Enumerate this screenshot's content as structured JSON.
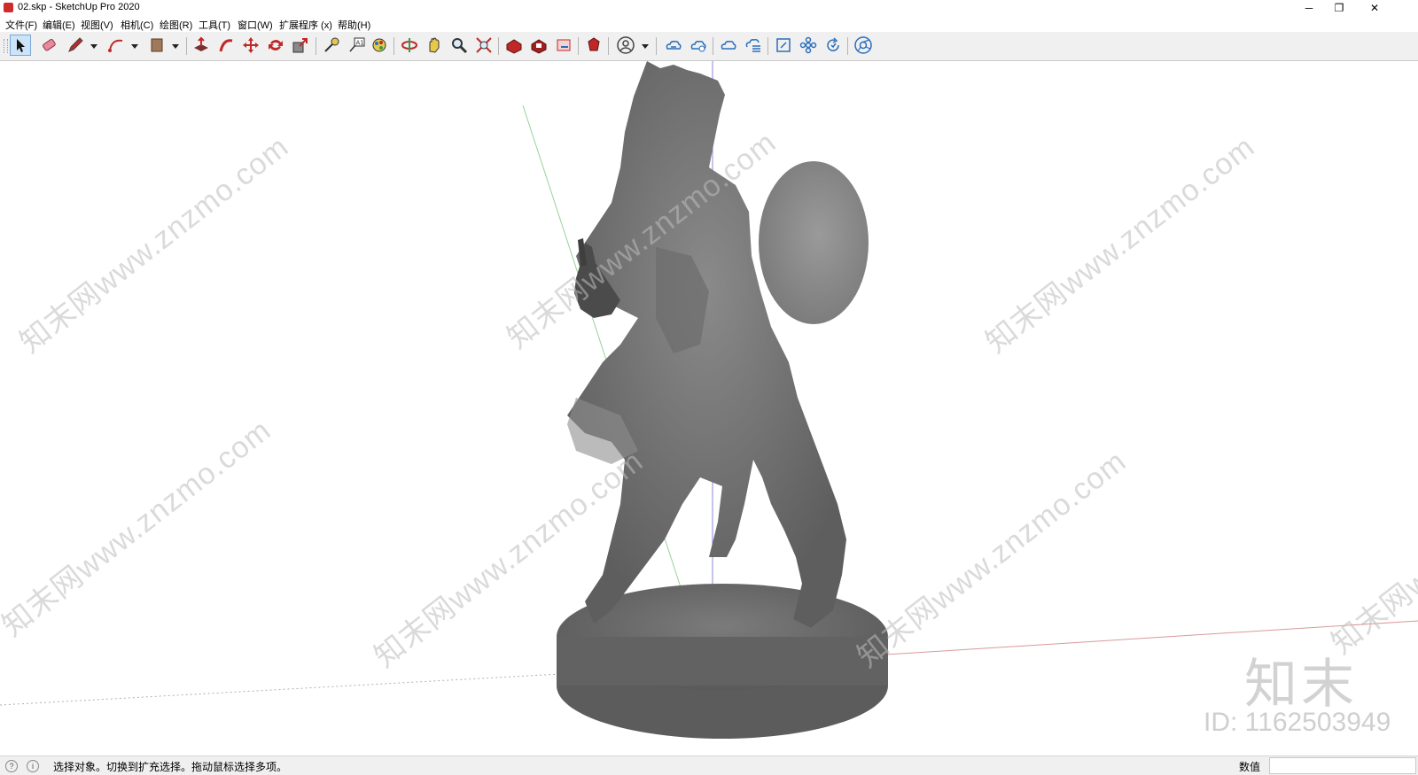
{
  "window": {
    "title": "02.skp - SketchUp Pro 2020",
    "controls": {
      "minimize": "─",
      "restore": "❐",
      "close": "✕"
    }
  },
  "menu": [
    {
      "label": "文件(F)"
    },
    {
      "label": "编辑(E)"
    },
    {
      "label": "视图(V)"
    },
    {
      "label": "相机(C)"
    },
    {
      "label": "绘图(R)"
    },
    {
      "label": "工具(T)"
    },
    {
      "label": "窗口(W)"
    },
    {
      "label": "扩展程序 (x)"
    },
    {
      "label": "帮助(H)"
    }
  ],
  "toolbar": {
    "tools": [
      "select-icon",
      "eraser-icon",
      "pencil-icon",
      "arc-icon",
      "paint-bucket-icon",
      "push-pull-icon",
      "follow-me-icon",
      "move-icon",
      "rotate-icon",
      "scale-icon",
      "tape-measure-icon",
      "text-label-icon",
      "paint-icon",
      "orbit-icon",
      "pan-icon",
      "zoom-icon",
      "zoom-extents-icon",
      "warehouse-icon",
      "extension-warehouse-icon",
      "layout-icon",
      "ruby-icon",
      "user-account-icon",
      "cloud-sync-icon",
      "cloud-share-icon",
      "cloud-upload-icon",
      "cloud-list-icon",
      "section-icon",
      "components-icon",
      "refresh-icon",
      "chrome-icon"
    ],
    "accent": "#2a6ebb"
  },
  "watermark": {
    "text": "知末网www.znzmo.com",
    "brand": "知末",
    "id": "ID: 1162503949"
  },
  "statusbar": {
    "message": "选择对象。切换到扩充选择。拖动鼠标选择多项。",
    "measure_label": "数值",
    "measure_value": ""
  }
}
